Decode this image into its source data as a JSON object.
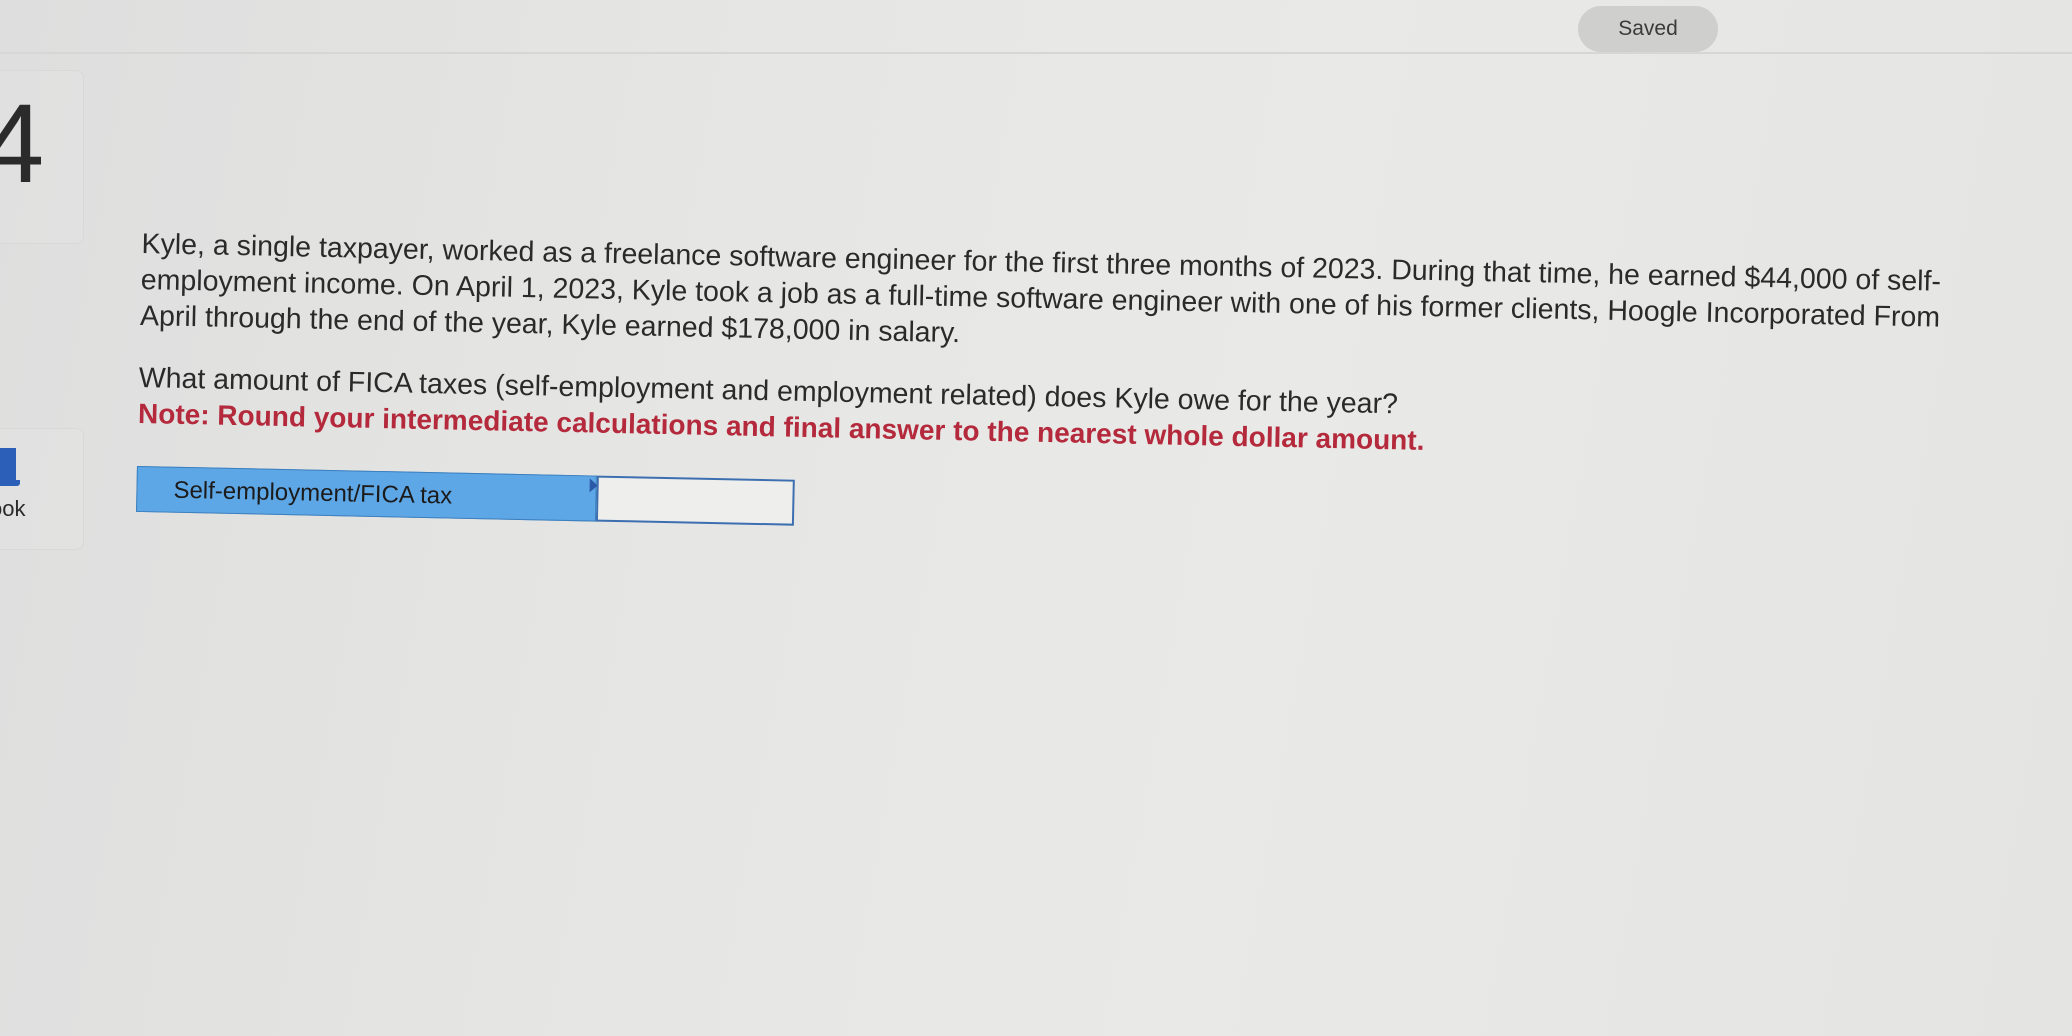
{
  "header": {
    "status_label": "Saved"
  },
  "sidebar": {
    "question_number": "4",
    "ebook_label": "ook"
  },
  "question": {
    "problem_text": "Kyle, a single taxpayer, worked as a freelance software engineer for the first three months of 2023. During that time, he earned $44,000 of self-employment income. On April 1, 2023, Kyle took a job as a full-time software engineer with one of his former clients, Hoogle Incorporated From April through the end of the year, Kyle earned $178,000 in salary.",
    "prompt_text": "What amount of FICA taxes (self-employment and employment related) does Kyle owe for the year?",
    "note_text": "Note: Round your intermediate calculations and final answer to the nearest whole dollar amount."
  },
  "answer": {
    "label": "Self-employment/FICA tax",
    "value": ""
  },
  "colors": {
    "note_red": "#b42a3c",
    "label_blue": "#5ea7e6",
    "input_border": "#3d6fb0"
  }
}
